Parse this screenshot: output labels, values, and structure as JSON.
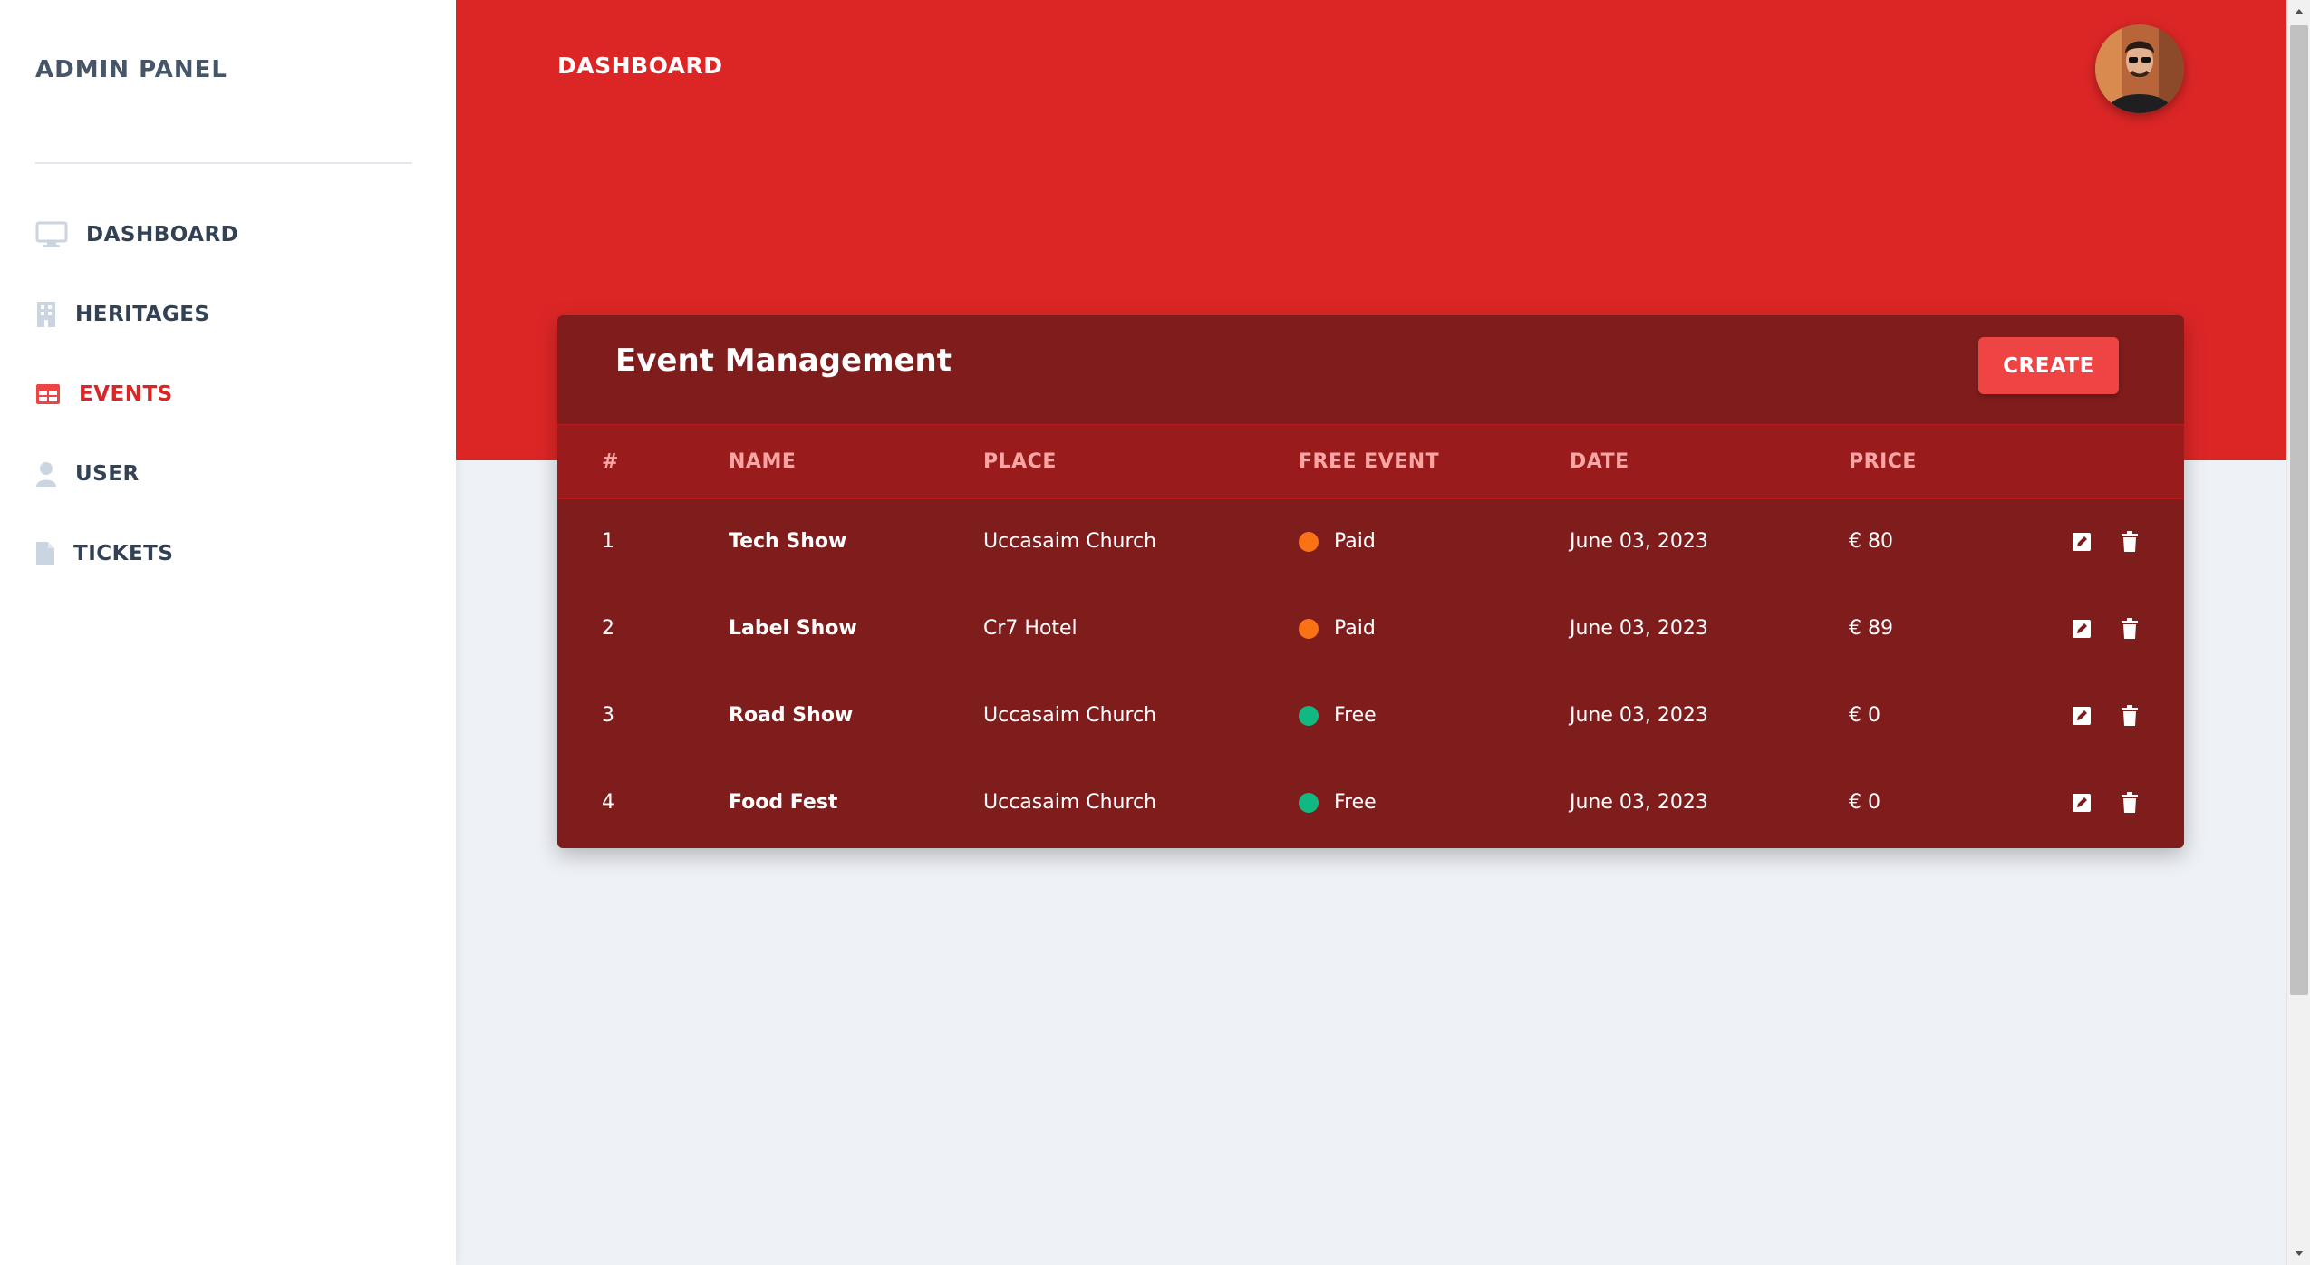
{
  "sidebar": {
    "brand": "ADMIN PANEL",
    "items": [
      {
        "label": "DASHBOARD",
        "icon": "monitor-icon"
      },
      {
        "label": "HERITAGES",
        "icon": "building-icon"
      },
      {
        "label": "EVENTS",
        "icon": "table-icon",
        "active": true
      },
      {
        "label": "USER",
        "icon": "user-icon"
      },
      {
        "label": "TICKETS",
        "icon": "file-icon"
      }
    ]
  },
  "header": {
    "title": "DASHBOARD",
    "avatar_icon": "user-avatar"
  },
  "events": {
    "title": "Event Management",
    "create_label": "CREATE",
    "columns": [
      "#",
      "NAME",
      "PLACE",
      "FREE EVENT",
      "DATE",
      "PRICE"
    ],
    "rows": [
      {
        "num": "1",
        "name": "Tech Show",
        "place": "Uccasaim Church",
        "status": "Paid",
        "date": "June 03, 2023",
        "price": "€ 80"
      },
      {
        "num": "2",
        "name": "Label Show",
        "place": "Cr7 Hotel",
        "status": "Paid",
        "date": "June 03, 2023",
        "price": "€ 89"
      },
      {
        "num": "3",
        "name": "Road Show",
        "place": "Uccasaim Church",
        "status": "Free",
        "date": "June 03, 2023",
        "price": "€ 0"
      },
      {
        "num": "4",
        "name": "Food Fest",
        "place": "Uccasaim Church",
        "status": "Free",
        "date": "June 03, 2023",
        "price": "€ 0"
      }
    ],
    "row_actions": [
      "edit-icon",
      "trash-icon"
    ]
  },
  "colors": {
    "accent": "#dc2626",
    "card": "#7f1d1d",
    "paid": "#f97316",
    "free": "#10b981"
  }
}
